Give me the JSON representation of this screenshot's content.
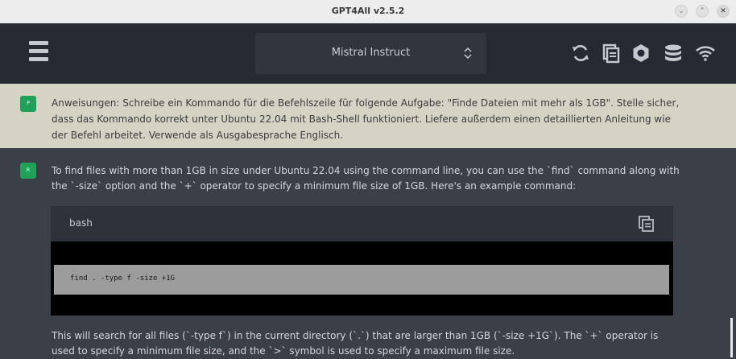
{
  "window": {
    "title": "GPT4All v2.5.2",
    "controls": {
      "minimize": "⌄",
      "maximize": "⌃",
      "close": "✕"
    }
  },
  "header": {
    "menu_icon": "hamburger-icon",
    "model_name": "Mistral Instruct",
    "icons": [
      "refresh-icon",
      "copy-conversation-icon",
      "settings-gear-icon",
      "database-icon",
      "network-wifi-icon"
    ]
  },
  "prompt": {
    "avatar": "P",
    "text": "Anweisungen: Schreibe ein Kommando für die Befehlszeile für folgende Aufgabe: \"Finde Dateien mit mehr als 1GB\". Stelle sicher, dass das Kommando korrekt unter Ubuntu 22.04 mit Bash-Shell funktioniert. Liefere außerdem einen detaillierten Anleitung wie der Befehl arbeitet. Verwende als Ausgabesprache Englisch."
  },
  "response": {
    "avatar": "R",
    "intro": "To find files with more than 1GB in size under Ubuntu 22.04 using the command line, you can use the `find` command along with the `-size` option and the `+` operator to specify a minimum file size of 1GB. Here's an example command:",
    "code": {
      "language": "bash",
      "command": "find . -type f -size +1G"
    },
    "explanation": "This will search for all files (`-type f`) in the current directory (`.`) that are larger than 1GB (`-size +1G`). The `+` operator is used to specify a minimum file size, and the `>` symbol is used to specify a maximum file size."
  },
  "colors": {
    "accent_green": "#21a059",
    "header_bg": "#262b33",
    "prompt_bg": "#d4d3c4",
    "response_bg": "#3b3f48"
  }
}
